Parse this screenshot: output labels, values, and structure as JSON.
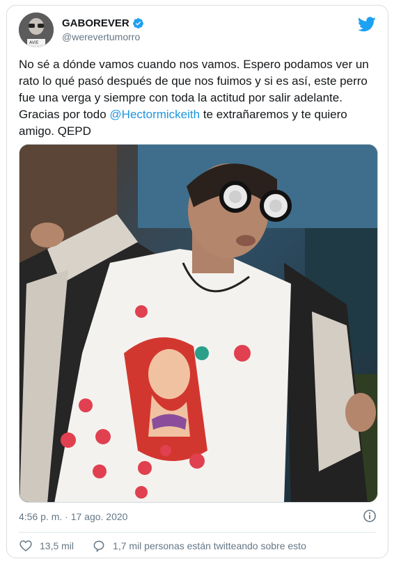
{
  "author": {
    "display_name": "GABOREVER",
    "handle": "@werevertumorro",
    "avatar_caption": "AVIE"
  },
  "tweet": {
    "text_before": "No sé a dónde vamos cuando nos vamos. Espero podamos ver un rato lo qué pasó después de que nos fuimos y si es así, este perro fue una verga y siempre con toda la actitud por salir adelante. Gracias por todo ",
    "mention": "@Hectormickeith",
    "text_after": " te extrañaremos y te quiero amigo. QEPD",
    "timestamp": "4:56 p. m. · 17 ago. 2020"
  },
  "actions": {
    "likes": "13,5 mil",
    "conversation": "1,7 mil personas están twitteando sobre esto"
  },
  "colors": {
    "accent": "#1da1f2",
    "mention": "#1b95e0",
    "muted": "#657786",
    "border": "#d9dee2"
  },
  "icons": [
    "twitter-bird-icon",
    "verified-badge-icon",
    "info-icon",
    "heart-icon",
    "comment-icon"
  ]
}
